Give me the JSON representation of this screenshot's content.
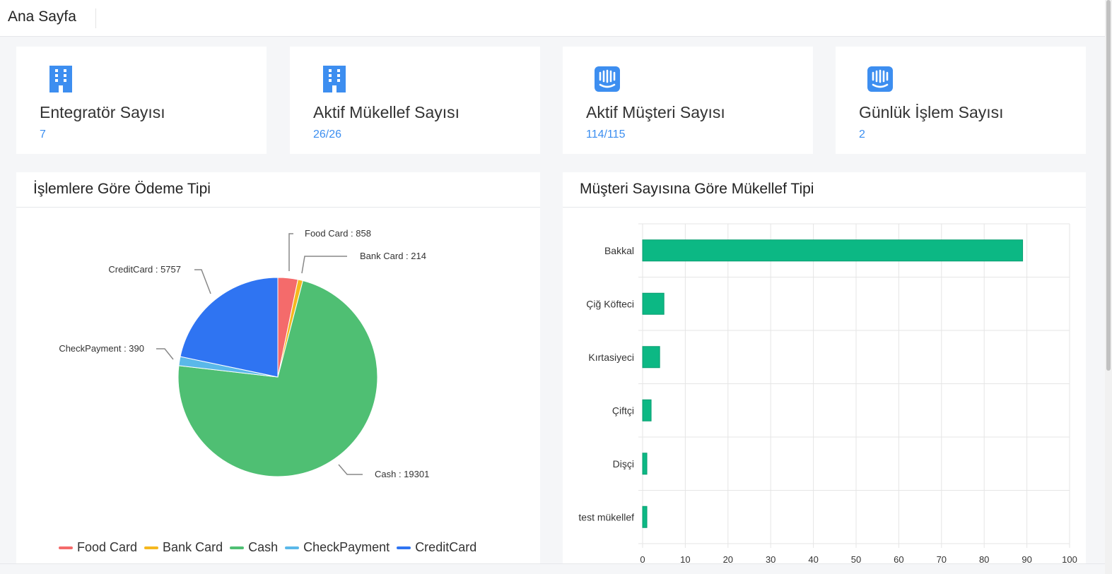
{
  "header": {
    "title": "Ana Sayfa"
  },
  "cards": [
    {
      "title": "Entegratör Sayısı",
      "value": "7",
      "icon": "building-icon"
    },
    {
      "title": "Aktif Mükellef Sayısı",
      "value": "26/26",
      "icon": "building-icon"
    },
    {
      "title": "Aktif Müşteri Sayısı",
      "value": "114/115",
      "icon": "intercom-icon"
    },
    {
      "title": "Günlük İşlem Sayısı",
      "value": "2",
      "icon": "intercom-icon"
    }
  ],
  "colors": {
    "accent": "#3b8ef0",
    "icon": "#3d8ef0",
    "bar": "#0cb884"
  },
  "pie_panel": {
    "title": "İşlemlere Göre Ödeme Tipi"
  },
  "bar_panel": {
    "title": "Müşteri Sayısına Göre Mükellef Tipi"
  },
  "chart_data": [
    {
      "type": "pie",
      "title": "İşlemlere Göre Ödeme Tipi",
      "slices": [
        {
          "label": "Food Card",
          "value": 858,
          "color": "#f46b6b",
          "text": "Food Card : 858"
        },
        {
          "label": "Bank Card",
          "value": 214,
          "color": "#f5b81f",
          "text": "Bank Card : 214"
        },
        {
          "label": "Cash",
          "value": 19301,
          "color": "#4fbf73",
          "text": "Cash : 19301"
        },
        {
          "label": "CheckPayment",
          "value": 390,
          "color": "#5ab8e9",
          "text": "CheckPayment : 390"
        },
        {
          "label": "CreditCard",
          "value": 5757,
          "color": "#2f74f2",
          "text": "CreditCard : 5757"
        }
      ],
      "legend": "bottom"
    },
    {
      "type": "bar",
      "orientation": "horizontal",
      "title": "Müşteri Sayısına Göre Mükellef Tipi",
      "categories": [
        "Bakkal",
        "Çiğ Köfteci",
        "Kırtasiyeci",
        "Çiftçi",
        "Dişçi",
        "test mükellef"
      ],
      "values": [
        89,
        5,
        4,
        2,
        1,
        1
      ],
      "xlim": [
        0,
        100
      ],
      "xticks": [
        "0",
        "10",
        "20",
        "30",
        "40",
        "50",
        "60",
        "70",
        "80",
        "90",
        "100"
      ],
      "grid": true
    }
  ]
}
